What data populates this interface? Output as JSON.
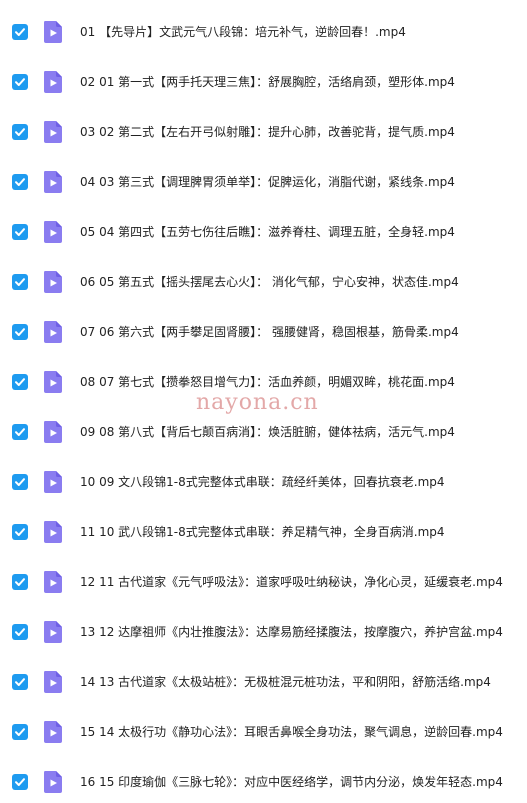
{
  "colors": {
    "checkbox": "#1e9bf0",
    "file_icon": "#8a7cf0",
    "file_icon_dark": "#6f5fe6",
    "text": "#222222",
    "watermark": "#e3a8a8"
  },
  "icons": {
    "checkbox": "checkmark-icon",
    "file": "video-file-icon"
  },
  "files": [
    {
      "name": "01 【先导片】文武元气八段锦：培元补气，逆龄回春！.mp4",
      "checked": true
    },
    {
      "name": "02 01 第一式【两手托天理三焦】：舒展胸腔，活络肩颈，塑形体.mp4",
      "checked": true
    },
    {
      "name": "03 02 第二式【左右开弓似射雕】：提升心肺，改善驼背，提气质.mp4",
      "checked": true
    },
    {
      "name": "04 03 第三式【调理脾胃须单举】：促脾运化，消脂代谢，紧线条.mp4",
      "checked": true
    },
    {
      "name": "05 04 第四式【五劳七伤往后瞧】：滋养脊柱、调理五脏，全身轻.mp4",
      "checked": true
    },
    {
      "name": "06 05 第五式【摇头摆尾去心火】： 消化气郁，宁心安神，状态佳.mp4",
      "checked": true
    },
    {
      "name": "07 06 第六式【两手攀足固肾腰】： 强腰健肾，稳固根基，筋骨柔.mp4",
      "checked": true
    },
    {
      "name": "08 07 第七式【攒拳怒目增气力】：活血养颜，明媚双眸，桃花面.mp4",
      "checked": true
    },
    {
      "name": "09 08 第八式【背后七颠百病消】：焕活脏腑，健体祛病，活元气.mp4",
      "checked": true
    },
    {
      "name": "10 09 文八段锦1-8式完整体式串联：疏经纤美体，回春抗衰老.mp4",
      "checked": true
    },
    {
      "name": "11 10 武八段锦1-8式完整体式串联：养足精气神，全身百病消.mp4",
      "checked": true
    },
    {
      "name": "12 11 古代道家《元气呼吸法》：道家呼吸吐纳秘诀，净化心灵，延缓衰老.mp4",
      "checked": true
    },
    {
      "name": "13 12 达摩祖师《内壮推腹法》：达摩易筋经揉腹法，按摩腹穴，养护宫盆.mp4",
      "checked": true
    },
    {
      "name": "14 13 古代道家《太极站桩》：无极桩混元桩功法，平和阴阳，舒筋活络.mp4",
      "checked": true
    },
    {
      "name": "15 14 太极行功《静功心法》：耳眼舌鼻喉全身功法，聚气调息，逆龄回春.mp4",
      "checked": true
    },
    {
      "name": "16 15 印度瑜伽《三脉七轮》：对应中医经络学，调节内分泌，焕发年轻态.mp4",
      "checked": true
    }
  ],
  "watermark": "nayona.cn"
}
